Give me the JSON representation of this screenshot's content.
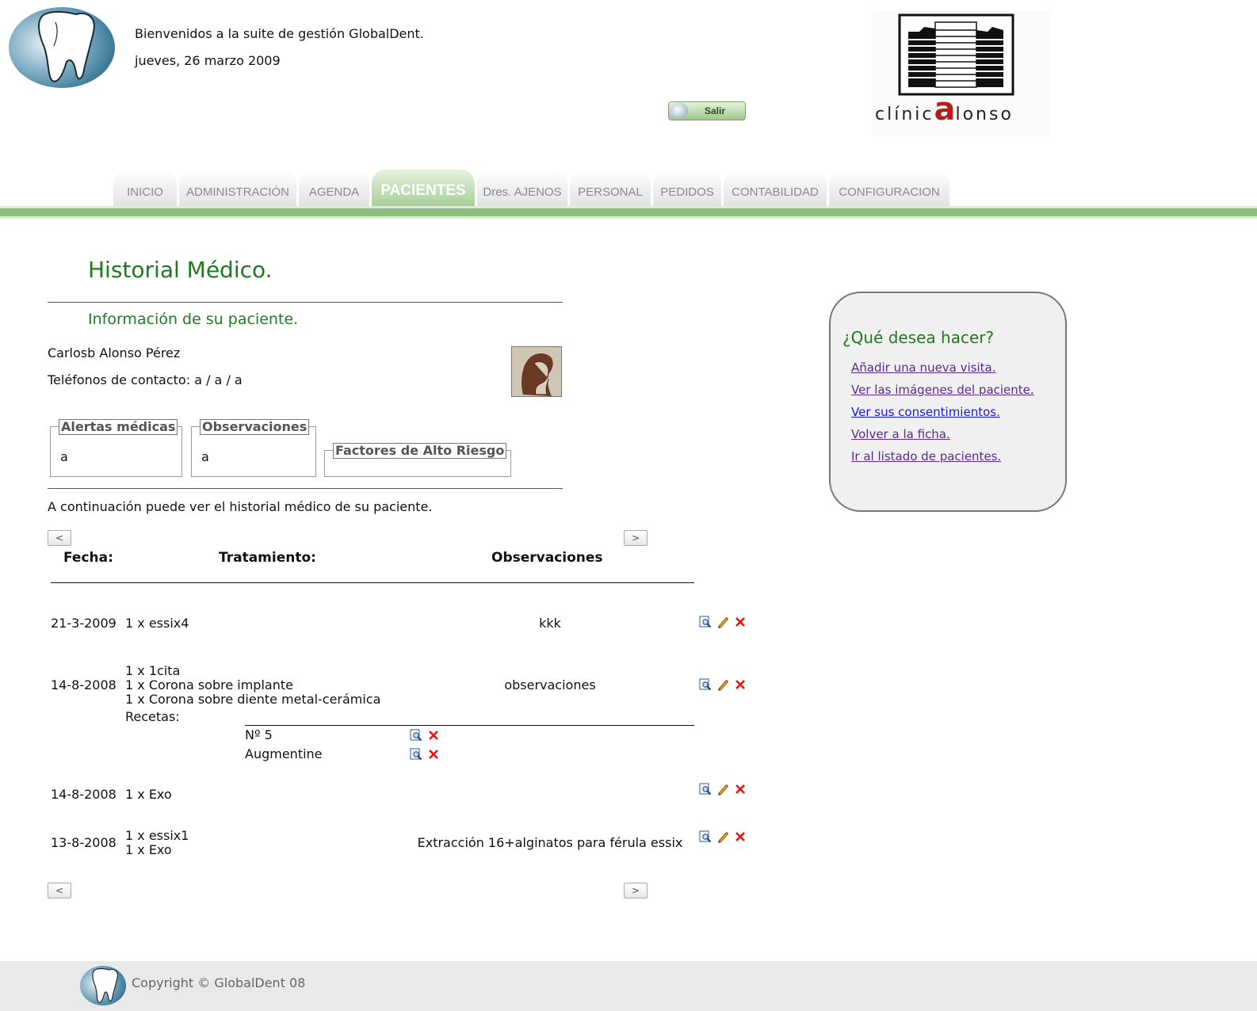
{
  "header": {
    "welcome": "Bienvenidos a la suite de gestión GlobalDent.",
    "date": "jueves, 26 marzo 2009",
    "exit_label": "Salir",
    "clinic_name_pre": "clínic",
    "clinic_name_big": "a",
    "clinic_name_post": "lonso"
  },
  "nav": {
    "tabs": [
      {
        "label": "INICIO"
      },
      {
        "label": "ADMINISTRACIÓN"
      },
      {
        "label": "AGENDA"
      },
      {
        "label": "PACIENTES",
        "active": true
      },
      {
        "label": "Dres. AJENOS"
      },
      {
        "label": "PERSONAL"
      },
      {
        "label": "PEDIDOS"
      },
      {
        "label": "CONTABILIDAD"
      },
      {
        "label": "CONFIGURACION"
      }
    ]
  },
  "main": {
    "title": "Historial Médico.",
    "section_title": "Información de su paciente.",
    "patient_name": "Carlosb Alonso Pérez",
    "phones": "Teléfonos de contacto: a / a / a",
    "alerts": {
      "legend": "Alertas médicas",
      "value": "a"
    },
    "observations": {
      "legend": "Observaciones",
      "value": "a"
    },
    "risk_factors": {
      "legend": "Factores de Alto Riesgo",
      "value": ""
    },
    "intro": "A continuación puede ver el historial médico de su paciente.",
    "pager": {
      "prev": "<",
      "next": ">"
    },
    "table": {
      "headers": {
        "date": "Fecha:",
        "treatment": "Tratamiento:",
        "observations": "Observaciones"
      },
      "rows": [
        {
          "date": "21-3-2009",
          "treatments": [
            "1 x essix4"
          ],
          "observations": "kkk"
        },
        {
          "date": "14-8-2008",
          "treatments": [
            "1 x 1cita",
            "1 x Corona sobre implante",
            "1 x Corona sobre diente metal-cerámica"
          ],
          "observations": "observaciones",
          "recipes_label": "Recetas:",
          "recipes": [
            "Nº 5",
            "Augmentine"
          ]
        },
        {
          "date": "14-8-2008",
          "treatments": [
            "1 x Exo"
          ],
          "observations": ""
        },
        {
          "date": "13-8-2008",
          "treatments": [
            "1 x essix1",
            "1 x Exo"
          ],
          "observations": "Extracción 16+alginatos para férula essix"
        }
      ]
    }
  },
  "sidebar": {
    "title": "¿Qué desea hacer?",
    "links": [
      "Añadir una nueva visita.",
      "Ver las imágenes del paciente.",
      "Ver sus consentimientos.",
      "Volver a la ficha.",
      "Ir al listado de pacientes."
    ]
  },
  "footer": {
    "copyright": "Copyright © GlobalDent 08"
  },
  "colors": {
    "accent_green": "#1f7a1f",
    "nav_bar": "#8cbf7c",
    "visited_link": "#5a2b8c",
    "link": "#1a1adb"
  },
  "icons": {
    "view": "magnifier-doc-icon",
    "edit": "pencil-icon",
    "delete": "red-x-icon"
  }
}
